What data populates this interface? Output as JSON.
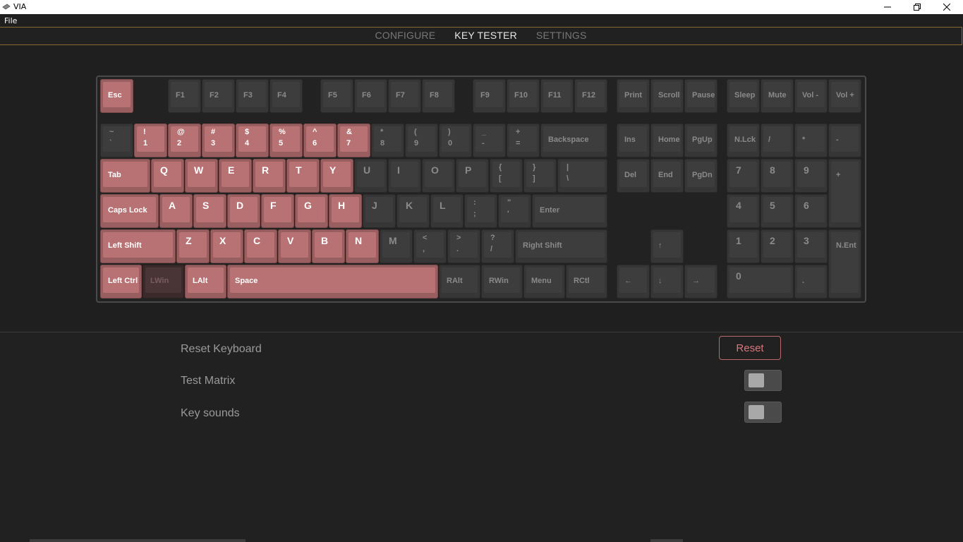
{
  "window": {
    "title": "VIA",
    "menu": [
      "File"
    ]
  },
  "nav": {
    "tabs": [
      {
        "label": "CONFIGURE",
        "active": false
      },
      {
        "label": "KEY TESTER",
        "active": true
      },
      {
        "label": "SETTINGS",
        "active": false
      }
    ]
  },
  "colors": {
    "pressed_key": "#b97274",
    "unpressed_key": "#3d3d3d",
    "accent_border": "#8a6a2a",
    "reset_text": "#d9777c"
  },
  "keyboard": {
    "layout": "full-size",
    "keys": [
      {
        "id": "esc",
        "label": "Esc",
        "state": "on"
      },
      {
        "id": "f1",
        "label": "F1",
        "state": "off"
      },
      {
        "id": "f2",
        "label": "F2",
        "state": "off"
      },
      {
        "id": "f3",
        "label": "F3",
        "state": "off"
      },
      {
        "id": "f4",
        "label": "F4",
        "state": "off"
      },
      {
        "id": "f5",
        "label": "F5",
        "state": "off"
      },
      {
        "id": "f6",
        "label": "F6",
        "state": "off"
      },
      {
        "id": "f7",
        "label": "F7",
        "state": "off"
      },
      {
        "id": "f8",
        "label": "F8",
        "state": "off"
      },
      {
        "id": "f9",
        "label": "F9",
        "state": "off"
      },
      {
        "id": "f10",
        "label": "F10",
        "state": "off"
      },
      {
        "id": "f11",
        "label": "F11",
        "state": "off"
      },
      {
        "id": "f12",
        "label": "F12",
        "state": "off"
      },
      {
        "id": "print",
        "label": "Print",
        "state": "off"
      },
      {
        "id": "scroll",
        "label": "Scroll",
        "state": "off"
      },
      {
        "id": "pause",
        "label": "Pause",
        "state": "off"
      },
      {
        "id": "sleep",
        "label": "Sleep",
        "state": "off"
      },
      {
        "id": "mute",
        "label": "Mute",
        "state": "off"
      },
      {
        "id": "voldown",
        "label": "Vol -",
        "state": "off"
      },
      {
        "id": "volup",
        "label": "Vol +",
        "state": "off"
      },
      {
        "id": "grave",
        "top": "~",
        "bottom": "`",
        "state": "off"
      },
      {
        "id": "1",
        "top": "!",
        "bottom": "1",
        "state": "on"
      },
      {
        "id": "2",
        "top": "@",
        "bottom": "2",
        "state": "on"
      },
      {
        "id": "3",
        "top": "#",
        "bottom": "3",
        "state": "on"
      },
      {
        "id": "4",
        "top": "$",
        "bottom": "4",
        "state": "on"
      },
      {
        "id": "5",
        "top": "%",
        "bottom": "5",
        "state": "on"
      },
      {
        "id": "6",
        "top": "^",
        "bottom": "6",
        "state": "on"
      },
      {
        "id": "7",
        "top": "&",
        "bottom": "7",
        "state": "on"
      },
      {
        "id": "8",
        "top": "*",
        "bottom": "8",
        "state": "off"
      },
      {
        "id": "9",
        "top": "(",
        "bottom": "9",
        "state": "off"
      },
      {
        "id": "0",
        "top": ")",
        "bottom": "0",
        "state": "off"
      },
      {
        "id": "minus",
        "top": "_",
        "bottom": "-",
        "state": "off"
      },
      {
        "id": "equal",
        "top": "+",
        "bottom": "=",
        "state": "off"
      },
      {
        "id": "backspace",
        "label": "Backspace",
        "state": "off"
      },
      {
        "id": "ins",
        "label": "Ins",
        "state": "off"
      },
      {
        "id": "home",
        "label": "Home",
        "state": "off"
      },
      {
        "id": "pgup",
        "label": "PgUp",
        "state": "off"
      },
      {
        "id": "numlock",
        "label": "N.Lck",
        "state": "off"
      },
      {
        "id": "numslash",
        "label": "/",
        "state": "off"
      },
      {
        "id": "numstar",
        "label": "*",
        "state": "off"
      },
      {
        "id": "numminus",
        "label": "-",
        "state": "off"
      },
      {
        "id": "tab",
        "label": "Tab",
        "state": "on"
      },
      {
        "id": "q",
        "label": "Q",
        "state": "on"
      },
      {
        "id": "w",
        "label": "W",
        "state": "on"
      },
      {
        "id": "e",
        "label": "E",
        "state": "on"
      },
      {
        "id": "r",
        "label": "R",
        "state": "on"
      },
      {
        "id": "t",
        "label": "T",
        "state": "on"
      },
      {
        "id": "y",
        "label": "Y",
        "state": "on"
      },
      {
        "id": "u",
        "label": "U",
        "state": "off"
      },
      {
        "id": "i",
        "label": "I",
        "state": "off"
      },
      {
        "id": "o",
        "label": "O",
        "state": "off"
      },
      {
        "id": "p",
        "label": "P",
        "state": "off"
      },
      {
        "id": "lbracket",
        "top": "{",
        "bottom": "[",
        "state": "off"
      },
      {
        "id": "rbracket",
        "top": "}",
        "bottom": "]",
        "state": "off"
      },
      {
        "id": "backslash",
        "top": "|",
        "bottom": "\\",
        "state": "off"
      },
      {
        "id": "del",
        "label": "Del",
        "state": "off"
      },
      {
        "id": "end",
        "label": "End",
        "state": "off"
      },
      {
        "id": "pgdn",
        "label": "PgDn",
        "state": "off"
      },
      {
        "id": "num7",
        "label": "7",
        "state": "off"
      },
      {
        "id": "num8",
        "label": "8",
        "state": "off"
      },
      {
        "id": "num9",
        "label": "9",
        "state": "off"
      },
      {
        "id": "numplus",
        "label": "+",
        "state": "off"
      },
      {
        "id": "caps",
        "label": "Caps Lock",
        "state": "on"
      },
      {
        "id": "a",
        "label": "A",
        "state": "on"
      },
      {
        "id": "s",
        "label": "S",
        "state": "on"
      },
      {
        "id": "d",
        "label": "D",
        "state": "on"
      },
      {
        "id": "f",
        "label": "F",
        "state": "on"
      },
      {
        "id": "g",
        "label": "G",
        "state": "on"
      },
      {
        "id": "h",
        "label": "H",
        "state": "on"
      },
      {
        "id": "j",
        "label": "J",
        "state": "off"
      },
      {
        "id": "k",
        "label": "K",
        "state": "off"
      },
      {
        "id": "l",
        "label": "L",
        "state": "off"
      },
      {
        "id": "semicolon",
        "top": ":",
        "bottom": ";",
        "state": "off"
      },
      {
        "id": "quote",
        "top": "\"",
        "bottom": "'",
        "state": "off"
      },
      {
        "id": "enter",
        "label": "Enter",
        "state": "off"
      },
      {
        "id": "num4",
        "label": "4",
        "state": "off"
      },
      {
        "id": "num5",
        "label": "5",
        "state": "off"
      },
      {
        "id": "num6",
        "label": "6",
        "state": "off"
      },
      {
        "id": "lshift",
        "label": "Left Shift",
        "state": "on"
      },
      {
        "id": "z",
        "label": "Z",
        "state": "on"
      },
      {
        "id": "x",
        "label": "X",
        "state": "on"
      },
      {
        "id": "c",
        "label": "C",
        "state": "on"
      },
      {
        "id": "v",
        "label": "V",
        "state": "on"
      },
      {
        "id": "b",
        "label": "B",
        "state": "on"
      },
      {
        "id": "n",
        "label": "N",
        "state": "on"
      },
      {
        "id": "m",
        "label": "M",
        "state": "off"
      },
      {
        "id": "comma",
        "top": "<",
        "bottom": ",",
        "state": "off"
      },
      {
        "id": "period",
        "top": ">",
        "bottom": ".",
        "state": "off"
      },
      {
        "id": "slash",
        "top": "?",
        "bottom": "/",
        "state": "off"
      },
      {
        "id": "rshift",
        "label": "Right Shift",
        "state": "off"
      },
      {
        "id": "up",
        "label": "↑",
        "state": "off"
      },
      {
        "id": "num1",
        "label": "1",
        "state": "off"
      },
      {
        "id": "num2",
        "label": "2",
        "state": "off"
      },
      {
        "id": "num3",
        "label": "3",
        "state": "off"
      },
      {
        "id": "numenter",
        "label": "N.Ent",
        "state": "off"
      },
      {
        "id": "lctrl",
        "label": "Left Ctrl",
        "state": "on"
      },
      {
        "id": "lwin",
        "label": "LWin",
        "state": "dim"
      },
      {
        "id": "lalt",
        "label": "LAlt",
        "state": "on"
      },
      {
        "id": "space",
        "label": "Space",
        "state": "on"
      },
      {
        "id": "ralt",
        "label": "RAlt",
        "state": "off"
      },
      {
        "id": "rwin",
        "label": "RWin",
        "state": "off"
      },
      {
        "id": "menu",
        "label": "Menu",
        "state": "off"
      },
      {
        "id": "rctl",
        "label": "RCtl",
        "state": "off"
      },
      {
        "id": "left",
        "label": "←",
        "state": "off"
      },
      {
        "id": "down",
        "label": "↓",
        "state": "off"
      },
      {
        "id": "right",
        "label": "→",
        "state": "off"
      },
      {
        "id": "num0",
        "label": "0",
        "state": "off"
      },
      {
        "id": "numdot",
        "label": ".",
        "state": "off"
      }
    ]
  },
  "settings": {
    "reset_keyboard_label": "Reset Keyboard",
    "reset_button_label": "Reset",
    "test_matrix_label": "Test Matrix",
    "test_matrix_on": false,
    "key_sounds_label": "Key sounds",
    "key_sounds_on": false
  }
}
